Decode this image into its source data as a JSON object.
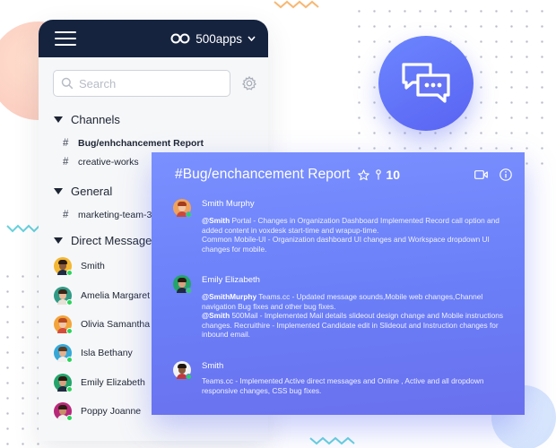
{
  "header": {
    "brand_label": "500apps"
  },
  "search": {
    "placeholder": "Search"
  },
  "sections": {
    "channels": "Channels",
    "general": "General",
    "direct_messages": "Direct Messages"
  },
  "channels": [
    {
      "hash": "#",
      "label": "Bug/enhchancement Report"
    },
    {
      "hash": "#",
      "label": "creative-works"
    }
  ],
  "general_channels": [
    {
      "hash": "#",
      "label": "marketing-team-3"
    }
  ],
  "direct_messages": [
    {
      "name": "Smith"
    },
    {
      "name": "Amelia Margaret"
    },
    {
      "name": "Olivia Samantha"
    },
    {
      "name": "Isla Bethany"
    },
    {
      "name": "Emily Elizabeth"
    },
    {
      "name": "Poppy Joanne"
    }
  ],
  "chat": {
    "title": "#Bug/enchancement Report",
    "member_count": "10",
    "messages": [
      {
        "author": "Smith Murphy",
        "lines": [
          {
            "mention": "@Smith",
            "text": " Portal - Changes in Organization Dashboard Implemented Record call option and added content in voxdesk start-time and wrapup-time."
          },
          {
            "mention": "",
            "text": "Common Mobile-UI - Organization dashboard UI changes and Workspace dropdown UI changes for mobile."
          }
        ]
      },
      {
        "author": "Emily Elizabeth",
        "lines": [
          {
            "mention": "@SmithMurphy",
            "text": " Teams.cc - Updated message sounds,Mobile web changes,Channel navigation Bug fixes and other bug fixes."
          },
          {
            "mention": "@Smith",
            "text": " 500Mail - Implemented Mail details slideout design change and Mobile instructions changes. Recruithire - Implemented Candidate edit in Slideout and Instruction changes for inbound email."
          }
        ]
      },
      {
        "author": "Smith",
        "lines": [
          {
            "mention": "",
            "text": "Teams.cc - Implemented Active direct messages and Online , Active and all dropdown responsive changes, CSS bug fixes."
          }
        ]
      }
    ]
  },
  "colors": {
    "header_bg": "#15233f",
    "chat_gradient_start": "#7a90ff",
    "chat_gradient_end": "#6a70ee",
    "presence_online": "#2bd35a"
  },
  "icons": {
    "menu": "hamburger-menu-icon",
    "brand": "infinity-logo-icon",
    "search": "search-icon",
    "settings": "gear-icon",
    "chat": "chat-bubbles-icon",
    "star": "star-icon",
    "pin": "pin-icon",
    "video": "video-camera-icon",
    "info": "info-icon"
  }
}
